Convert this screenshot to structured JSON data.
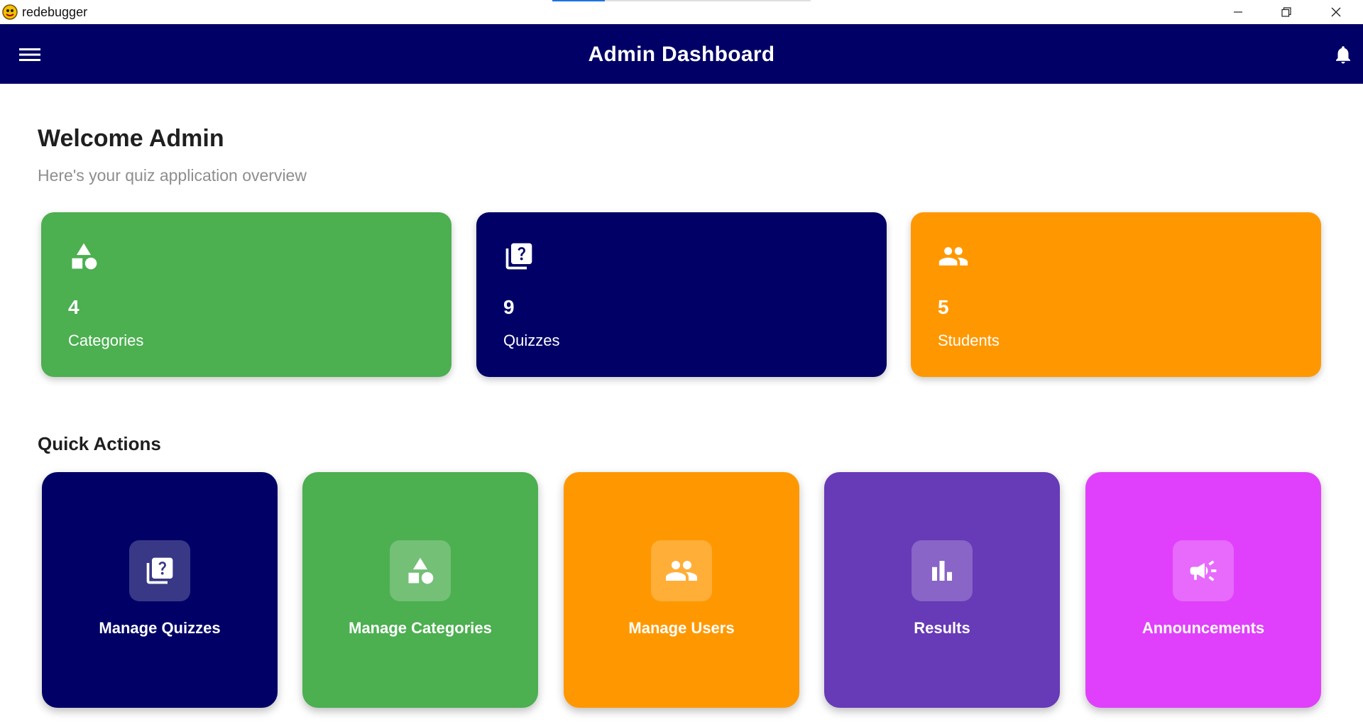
{
  "window": {
    "title": "redebugger",
    "controls": {
      "minimize": "minimize-icon",
      "restore": "restore-icon",
      "close": "close-icon"
    }
  },
  "appbar": {
    "title": "Admin Dashboard",
    "menu_icon": "menu-icon",
    "notification_icon": "bell-icon",
    "background": "#000066"
  },
  "welcome": {
    "title": "Welcome Admin",
    "subtitle": "Here's your quiz application overview"
  },
  "stats": [
    {
      "value": "4",
      "label": "Categories",
      "icon": "category-icon",
      "color": "#4caf50"
    },
    {
      "value": "9",
      "label": "Quizzes",
      "icon": "quiz-icon",
      "color": "#000066"
    },
    {
      "value": "5",
      "label": "Students",
      "icon": "people-icon",
      "color": "#ff9800"
    }
  ],
  "quick_actions": {
    "title": "Quick Actions",
    "items": [
      {
        "label": "Manage Quizzes",
        "icon": "quiz-icon",
        "color": "#000066"
      },
      {
        "label": "Manage Categories",
        "icon": "category-icon",
        "color": "#4caf50"
      },
      {
        "label": "Manage Users",
        "icon": "people-icon",
        "color": "#ff9800"
      },
      {
        "label": "Results",
        "icon": "bar-chart-icon",
        "color": "#673ab7"
      },
      {
        "label": "Announcements",
        "icon": "campaign-icon",
        "color": "#e040fb"
      }
    ]
  }
}
